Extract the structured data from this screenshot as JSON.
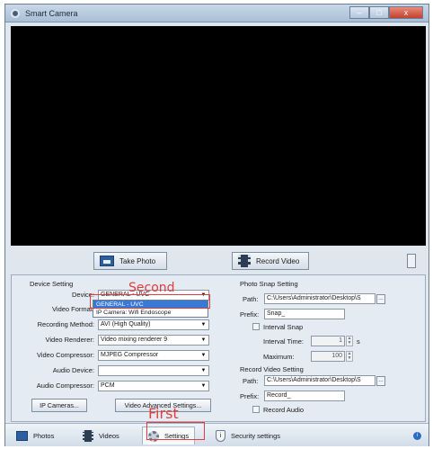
{
  "window": {
    "title": "Smart Camera",
    "minimize": "–",
    "maximize": "□",
    "close": "x"
  },
  "toolbar": {
    "take_photo": "Take Photo",
    "record_video": "Record Video"
  },
  "device_setting": {
    "title": "Device Setting",
    "device_label": "Device:",
    "device_value": "GENERAL - UVC",
    "device_options": [
      "GENERAL - UVC",
      "IP Camera: Wifi Endoscope"
    ],
    "video_format_label": "Video Format:",
    "recording_method_label": "Recording Method:",
    "recording_method_value": "AVI (High Quality)",
    "video_renderer_label": "Video Renderer:",
    "video_renderer_value": "Video mixing renderer 9",
    "video_compressor_label": "Video Compressor:",
    "video_compressor_value": "MJPEG Compressor",
    "audio_device_label": "Audio Device:",
    "audio_device_value": "",
    "audio_compressor_label": "Audio Compressor:",
    "audio_compressor_value": "PCM",
    "ip_cameras_button": "IP Cameras...",
    "video_advanced_button": "Video Advanced Settings..."
  },
  "photo_snap": {
    "title": "Photo Snap Setting",
    "path_label": "Path:",
    "path_value": "C:\\Users\\Administrator\\Desktop\\S",
    "prefix_label": "Prefix:",
    "prefix_value": "Snap_",
    "interval_snap_label": "Interval Snap",
    "interval_time_label": "Interval Time:",
    "interval_time_value": "1",
    "interval_unit": "s",
    "maximum_label": "Maximum:",
    "maximum_value": "100"
  },
  "record_video": {
    "title": "Record Video Setting",
    "path_label": "Path:",
    "path_value": "C:\\Users\\Administrator\\Desktop\\S",
    "prefix_label": "Prefix:",
    "prefix_value": "Record_",
    "record_audio_label": "Record Audio"
  },
  "tabs": [
    {
      "label": "Photos"
    },
    {
      "label": "Videos"
    },
    {
      "label": "Settings"
    },
    {
      "label": "Security settings"
    }
  ],
  "annotations": {
    "second": "Second",
    "first": "First",
    "color": "#e23c3c"
  },
  "colors": {
    "accent": "#3a78d6",
    "selection": "#3a78d6"
  }
}
